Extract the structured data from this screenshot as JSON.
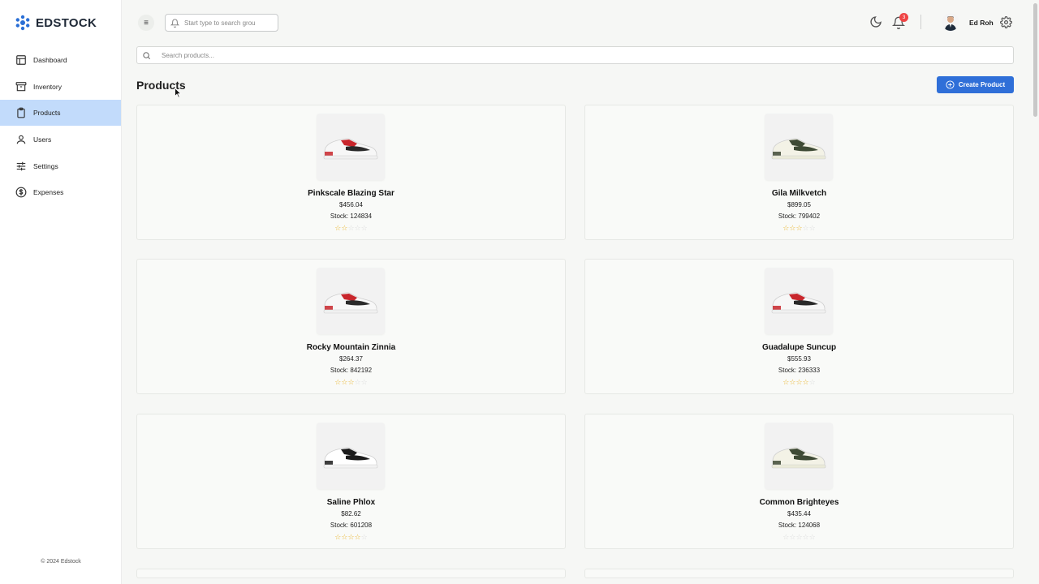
{
  "brand": {
    "name": "EDSTOCK"
  },
  "sidebar": {
    "items": [
      {
        "label": "Dashboard",
        "icon": "layout-icon",
        "active": false
      },
      {
        "label": "Inventory",
        "icon": "archive-icon",
        "active": false
      },
      {
        "label": "Products",
        "icon": "clipboard-icon",
        "active": true
      },
      {
        "label": "Users",
        "icon": "user-icon",
        "active": false
      },
      {
        "label": "Settings",
        "icon": "sliders-icon",
        "active": false
      },
      {
        "label": "Expenses",
        "icon": "dollar-circle-icon",
        "active": false
      }
    ],
    "footer": "© 2024 Edstock"
  },
  "topbar": {
    "search_placeholder": "Start type to search grou",
    "notification_count": "3",
    "user_name": "Ed Roh"
  },
  "main": {
    "search_placeholder": "Search products...",
    "title": "Products",
    "create_label": "Create Product"
  },
  "products": [
    {
      "name": "Pinkscale Blazing Star",
      "price": "$456.04",
      "stock": "Stock: 124834",
      "rating": 2,
      "shoe": "red"
    },
    {
      "name": "Gila Milkvetch",
      "price": "$899.05",
      "stock": "Stock: 799402",
      "rating": 3,
      "shoe": "green"
    },
    {
      "name": "Rocky Mountain Zinnia",
      "price": "$264.37",
      "stock": "Stock: 842192",
      "rating": 3,
      "shoe": "red"
    },
    {
      "name": "Guadalupe Suncup",
      "price": "$555.93",
      "stock": "Stock: 236333",
      "rating": 4,
      "shoe": "red"
    },
    {
      "name": "Saline Phlox",
      "price": "$82.62",
      "stock": "Stock: 601208",
      "rating": 4,
      "shoe": "black"
    },
    {
      "name": "Common Brighteyes",
      "price": "$435.44",
      "stock": "Stock: 124068",
      "rating": 0,
      "shoe": "green"
    }
  ],
  "colors": {
    "accent": "#2f6fd8",
    "active_nav": "#c2dbfb",
    "star": "#e8b020",
    "badge": "#ef4444"
  }
}
